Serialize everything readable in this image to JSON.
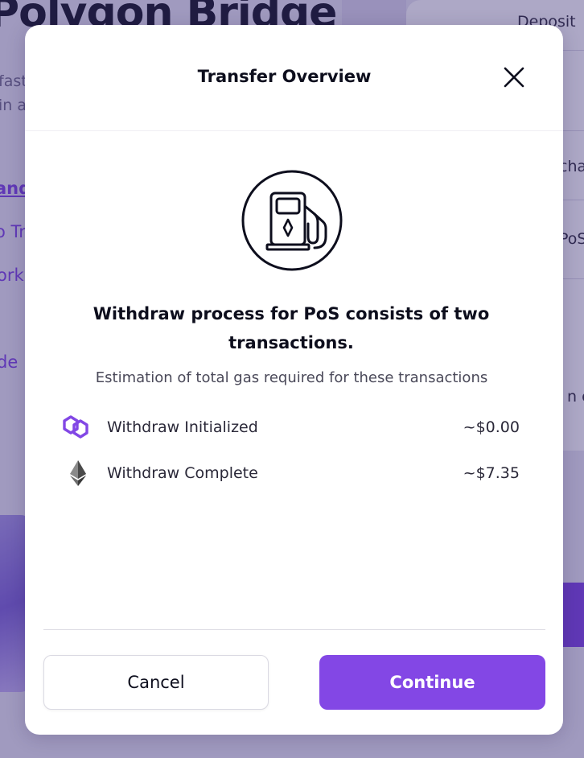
{
  "background": {
    "title": "Polygon Bridge",
    "intro_lines": [
      "fast",
      "in a"
    ],
    "links": [
      "andr",
      "o Tr",
      "ork",
      "de"
    ],
    "card": {
      "tab_label": "Deposit",
      "rows": [
        "cha",
        "PoS",
        "n ch"
      ]
    }
  },
  "modal": {
    "title": "Transfer Overview",
    "close_icon": "close-icon",
    "hero_icon": "gas-pump-icon",
    "headline": "Withdraw process for PoS consists of two transactions.",
    "subtitle": "Estimation of total gas required for these transactions",
    "transactions": [
      {
        "label": "Withdraw Initialized",
        "value": "~$0.00",
        "icon": "polygon-icon",
        "color": "#8247e5"
      },
      {
        "label": "Withdraw Complete",
        "value": "~$7.35",
        "icon": "ethereum-icon",
        "color": "#3c3c3d"
      }
    ],
    "buttons": {
      "cancel": "Cancel",
      "continue": "Continue"
    }
  },
  "colors": {
    "accent": "#8347e5",
    "text": "#0d0e1d",
    "overlay": "#3c3078"
  }
}
